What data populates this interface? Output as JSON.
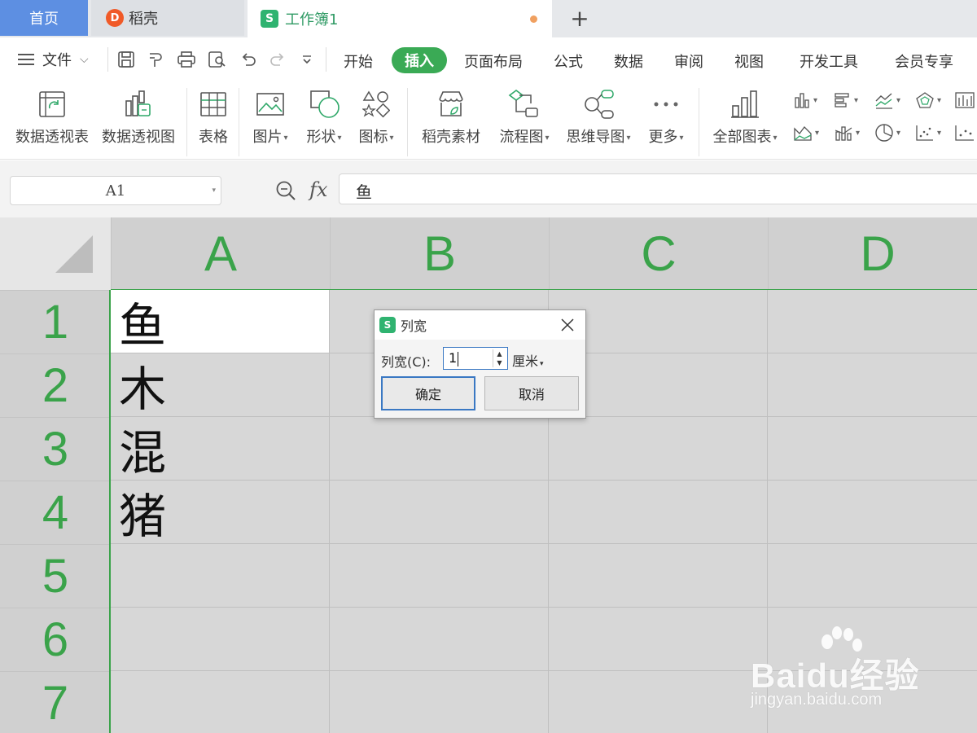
{
  "tabs": {
    "home": "首页",
    "daoke": "稻壳",
    "workbook": "工作簿1",
    "add_icon": "plus-icon"
  },
  "menu": {
    "file": "文件",
    "items": [
      "开始",
      "插入",
      "页面布局",
      "公式",
      "数据",
      "审阅",
      "视图",
      "开发工具",
      "会员专享"
    ],
    "active": "插入"
  },
  "ribbon": {
    "pivot_table": "数据透视表",
    "pivot_chart": "数据透视图",
    "table": "表格",
    "picture": "图片",
    "shape": "形状",
    "icon": "图标",
    "daoke_assets": "稻壳素材",
    "flowchart": "流程图",
    "mindmap": "思维导图",
    "more": "更多",
    "all_charts": "全部图表"
  },
  "formula_bar": {
    "name_box": "A1",
    "fx": "fx",
    "content": "鱼"
  },
  "sheet": {
    "columns": [
      "A",
      "B",
      "C",
      "D"
    ],
    "rows": [
      "1",
      "2",
      "3",
      "4",
      "5",
      "6",
      "7"
    ],
    "colA": [
      "鱼",
      "木",
      "混",
      "猪",
      "",
      "",
      ""
    ]
  },
  "dialog": {
    "title": "列宽",
    "label": "列宽(C):",
    "value": "1",
    "unit": "厘米",
    "ok": "确定",
    "cancel": "取消"
  },
  "watermark": {
    "main": "Baidu经验",
    "sub": "jingyan.baidu.com"
  },
  "colors": {
    "accent_green": "#3aa34a",
    "home_tab_blue": "#5d8fe2",
    "dialog_focus_blue": "#3a78c3"
  }
}
